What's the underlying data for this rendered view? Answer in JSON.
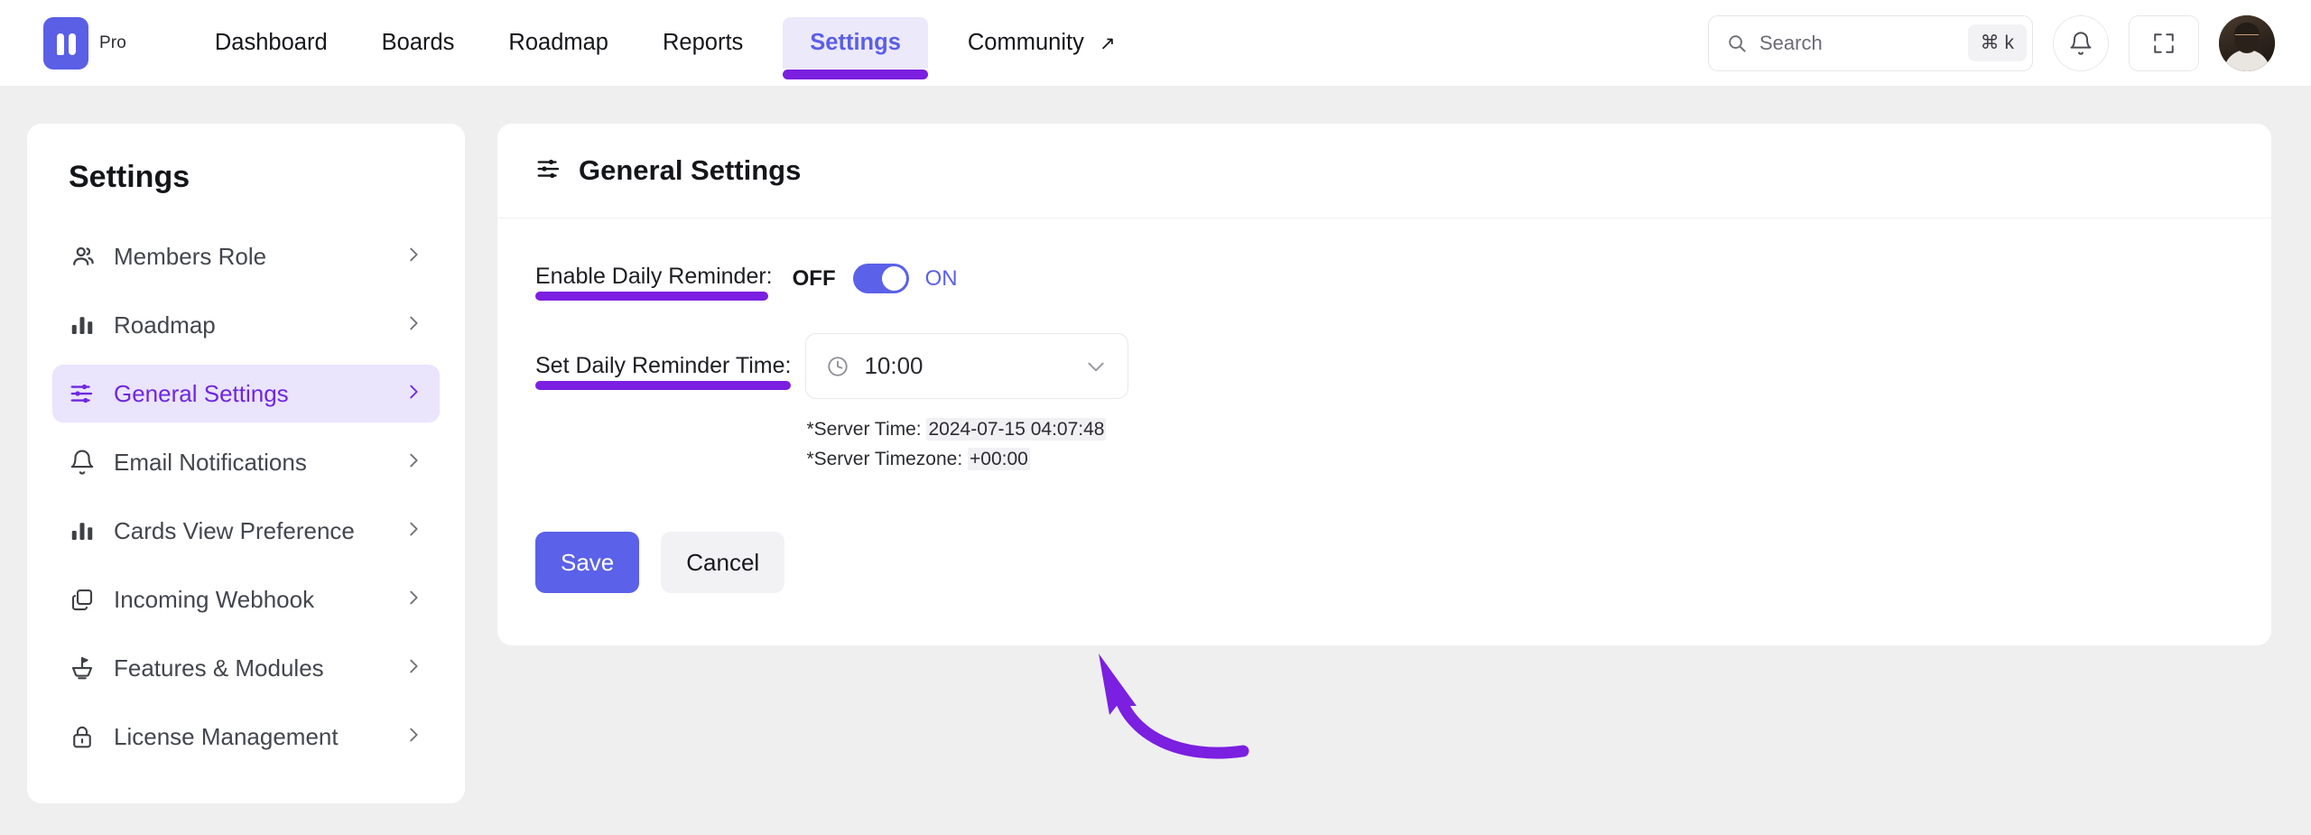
{
  "topnav": {
    "brand": {
      "logo_icon": "app-logo-icon",
      "badge": "Pro"
    },
    "links": [
      {
        "label": "Dashboard",
        "active": false,
        "external": false
      },
      {
        "label": "Boards",
        "active": false,
        "external": false
      },
      {
        "label": "Roadmap",
        "active": false,
        "external": false
      },
      {
        "label": "Reports",
        "active": false,
        "external": false
      },
      {
        "label": "Settings",
        "active": true,
        "external": false
      },
      {
        "label": "Community",
        "active": false,
        "external": true
      }
    ],
    "external_glyph": "↗",
    "search": {
      "placeholder": "Search",
      "shortcut": "⌘ k",
      "icon": "search-icon"
    },
    "notifications_icon": "bell-icon",
    "fullscreen_icon": "fullscreen-icon",
    "avatar": "user-avatar"
  },
  "sidebar": {
    "title": "Settings",
    "items": [
      {
        "label": "Members Role",
        "icon": "users-icon",
        "active": false
      },
      {
        "label": "Roadmap",
        "icon": "bar-chart-icon",
        "active": false
      },
      {
        "label": "General Settings",
        "icon": "sliders-icon",
        "active": true
      },
      {
        "label": "Email Notifications",
        "icon": "bell-icon",
        "active": false
      },
      {
        "label": "Cards View Preference",
        "icon": "bar-chart-icon",
        "active": false
      },
      {
        "label": "Incoming Webhook",
        "icon": "copy-icon",
        "active": false
      },
      {
        "label": "Features & Modules",
        "icon": "flag-boat-icon",
        "active": false
      },
      {
        "label": "License Management",
        "icon": "lock-icon",
        "active": false
      }
    ],
    "chevron_glyph": "›"
  },
  "main": {
    "header": {
      "icon": "sliders-icon",
      "title": "General Settings"
    },
    "fields": {
      "enable_reminder": {
        "label": "Enable Daily Reminder:",
        "off_label": "OFF",
        "on_label": "ON",
        "state": "ON"
      },
      "reminder_time": {
        "label": "Set Daily Reminder Time:",
        "icon": "clock-icon",
        "value": "10:00",
        "caret": "chevron-down-icon"
      }
    },
    "server_info": {
      "time_label": "*Server Time:",
      "time_value": "2024-07-15 04:07:48",
      "timezone_label": "*Server Timezone:",
      "timezone_value": "+00:00"
    },
    "buttons": {
      "save": "Save",
      "cancel": "Cancel"
    }
  },
  "annotations": {
    "highlight_color": "#7b1fe0",
    "arrow_color": "#7b1fe0",
    "arrow_target": "save-button"
  },
  "colors": {
    "accent": "#5b61e8",
    "accent_purple": "#6d28e0",
    "page_bg": "#efefef",
    "card_bg": "#ffffff"
  }
}
